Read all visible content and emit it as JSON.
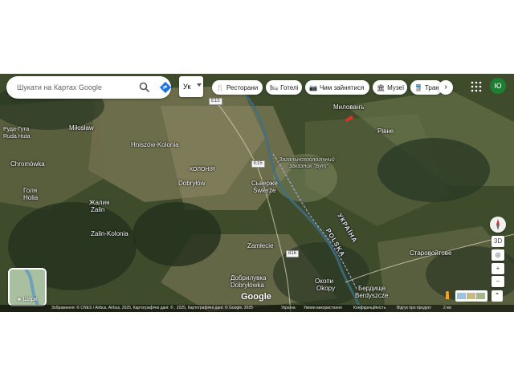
{
  "search": {
    "placeholder": "Шукати на Картах Google"
  },
  "language": {
    "label": "Ук"
  },
  "chips": [
    {
      "label": "Ресторани",
      "icon": "fork-knife-icon"
    },
    {
      "label": "Готелі",
      "icon": "bed-icon"
    },
    {
      "label": "Чим зайнятися",
      "icon": "camera-icon"
    },
    {
      "label": "Музеї",
      "icon": "museum-icon"
    },
    {
      "label": "Транс",
      "icon": "transit-icon"
    }
  ],
  "account": {
    "initial": "Ю"
  },
  "layers": {
    "label": "Шари"
  },
  "controls": {
    "tilt": "3D",
    "zoom_in": "+",
    "zoom_out": "−"
  },
  "brand": {
    "logo": "Google"
  },
  "footer": {
    "attribution": "Зображення: © CNES / Airbus, Airbus, 2025,  Картографічні дані: ©  , 2025,  Картографічні дані: © Google, 2025",
    "region": "Україна",
    "terms": "Умови використання",
    "privacy": "Конфіденційність",
    "feedback": "Відгук про продукт",
    "scale": "2 км"
  },
  "places": {
    "ruda_hut": "Руда-Гута",
    "ruda_huta": "Ruda Huta",
    "milostaw": "Miłosław",
    "hniszow": "Hniszów-Kolonia",
    "chromowka": "Chromówka",
    "holia_ua": "Голя",
    "holia": "Holia",
    "zhalin_ua": "Жалин",
    "zalin": "Zalin",
    "zalin_kolonia": "Zalin-Kolonia",
    "dobrylow": "Dobryłów",
    "kolonia_small": "КОЛОНІЯ",
    "swierze_ua": "Сьверже",
    "swierze": "Świerże",
    "zamlecie": "Zamłecie",
    "dobrylowka_ua": "Добрилувка",
    "dobrylowka": "Dobryłówka",
    "okopy_ua": "Окопи",
    "okopy": "Okopy",
    "berdyshche_ua": "Бердище",
    "berdyshche": "Berdyszcze",
    "mylovan": "Милованъ",
    "rivne": "Рівне",
    "starovoitove": "Старовойтове",
    "reserve_1": "Загальнозоологічний",
    "reserve_2": "заказник \"Бут\"",
    "border_ua": "УКРАЇНА",
    "border_pl": "POLSKA",
    "road_e15a": "E15",
    "road_e15b": "E15",
    "road_e16": "816"
  },
  "colors": {
    "river": "#3f6f86",
    "border": "#b9b9ff",
    "pin": "#d93025"
  }
}
